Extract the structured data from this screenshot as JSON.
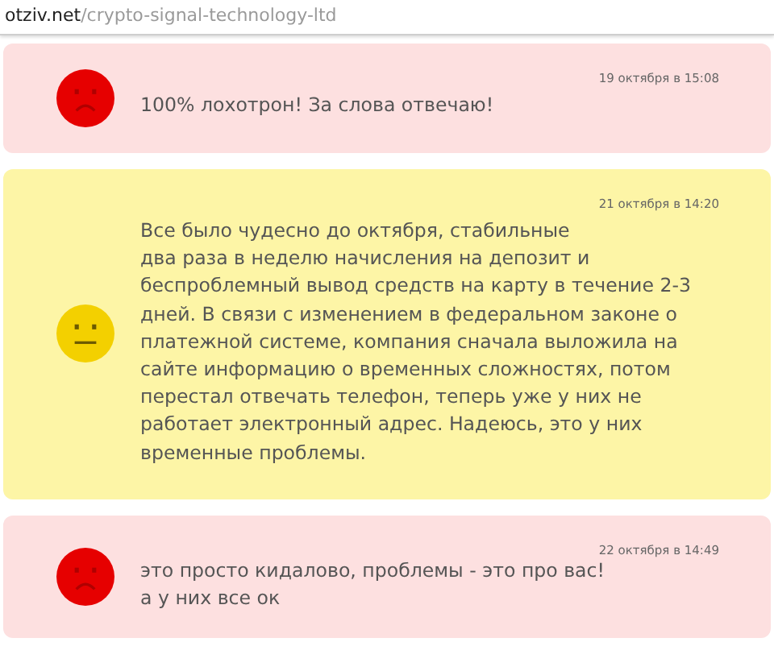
{
  "url": {
    "domain": "otziv.net",
    "path": "/crypto-signal-technology-ltd"
  },
  "reviews": [
    {
      "kind": "negative",
      "date": "19 октября в 15:08",
      "text": "100% лохотрон! За слова отвечаю!"
    },
    {
      "kind": "neutral",
      "date": "21 октября в 14:20",
      "text": "Все было чудесно до октября, стабильные\nдва раза в неделю начисления на депозит и беспроблемный вывод средств на карту в течение 2-3 дней. В связи с изменением в федеральном законе о платежной системе, компания сначала выложила на сайте информацию о временных сложностях, потом перестал отвечать телефон, теперь уже у них не работает электронный адрес. Надеюсь, это у них временные проблемы."
    },
    {
      "kind": "negative",
      "date": "22 октября в 14:49",
      "text": "это просто кидалово, проблемы - это про вас! а у них все ок"
    }
  ]
}
